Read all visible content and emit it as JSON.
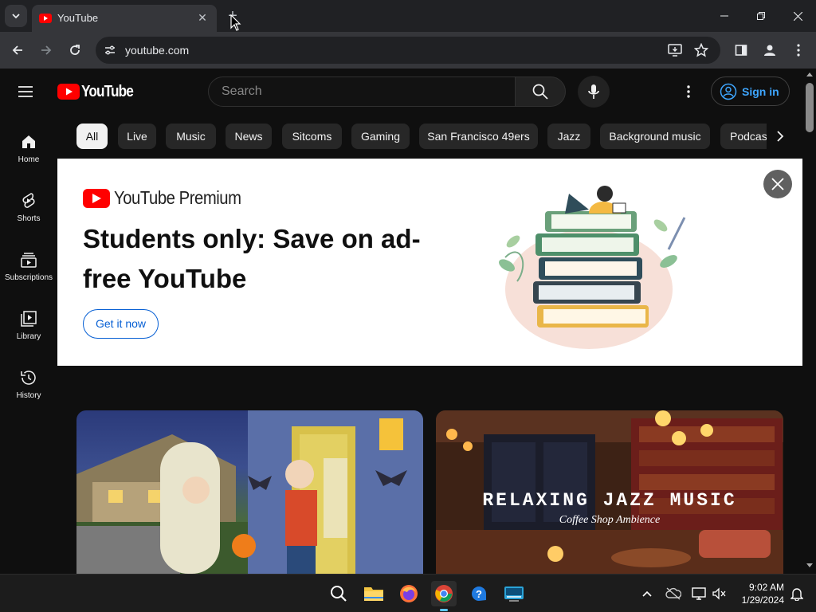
{
  "browser": {
    "tab_title": "YouTube",
    "url": "youtube.com"
  },
  "youtube": {
    "logo_text": "YouTube",
    "search_placeholder": "Search",
    "signin_label": "Sign in",
    "sidebar": [
      {
        "label": "Home",
        "icon": "home-icon"
      },
      {
        "label": "Shorts",
        "icon": "shorts-icon"
      },
      {
        "label": "Subscriptions",
        "icon": "subscriptions-icon"
      },
      {
        "label": "Library",
        "icon": "library-icon"
      },
      {
        "label": "History",
        "icon": "history-icon"
      }
    ],
    "chips": [
      "All",
      "Live",
      "Music",
      "News",
      "Sitcoms",
      "Gaming",
      "San Francisco 49ers",
      "Jazz",
      "Background music",
      "Podcasts"
    ],
    "banner": {
      "brand": "YouTube Premium",
      "headline": "Students only: Save on ad-free YouTube",
      "cta": "Get it now"
    },
    "thumbnails": [
      {
        "overlay_title": "",
        "overlay_sub": ""
      },
      {
        "overlay_title": "RELAXING JAZZ MUSIC",
        "overlay_sub": "Coffee Shop Ambience"
      }
    ]
  },
  "taskbar": {
    "time": "9:02 AM",
    "date": "1/29/2024"
  }
}
